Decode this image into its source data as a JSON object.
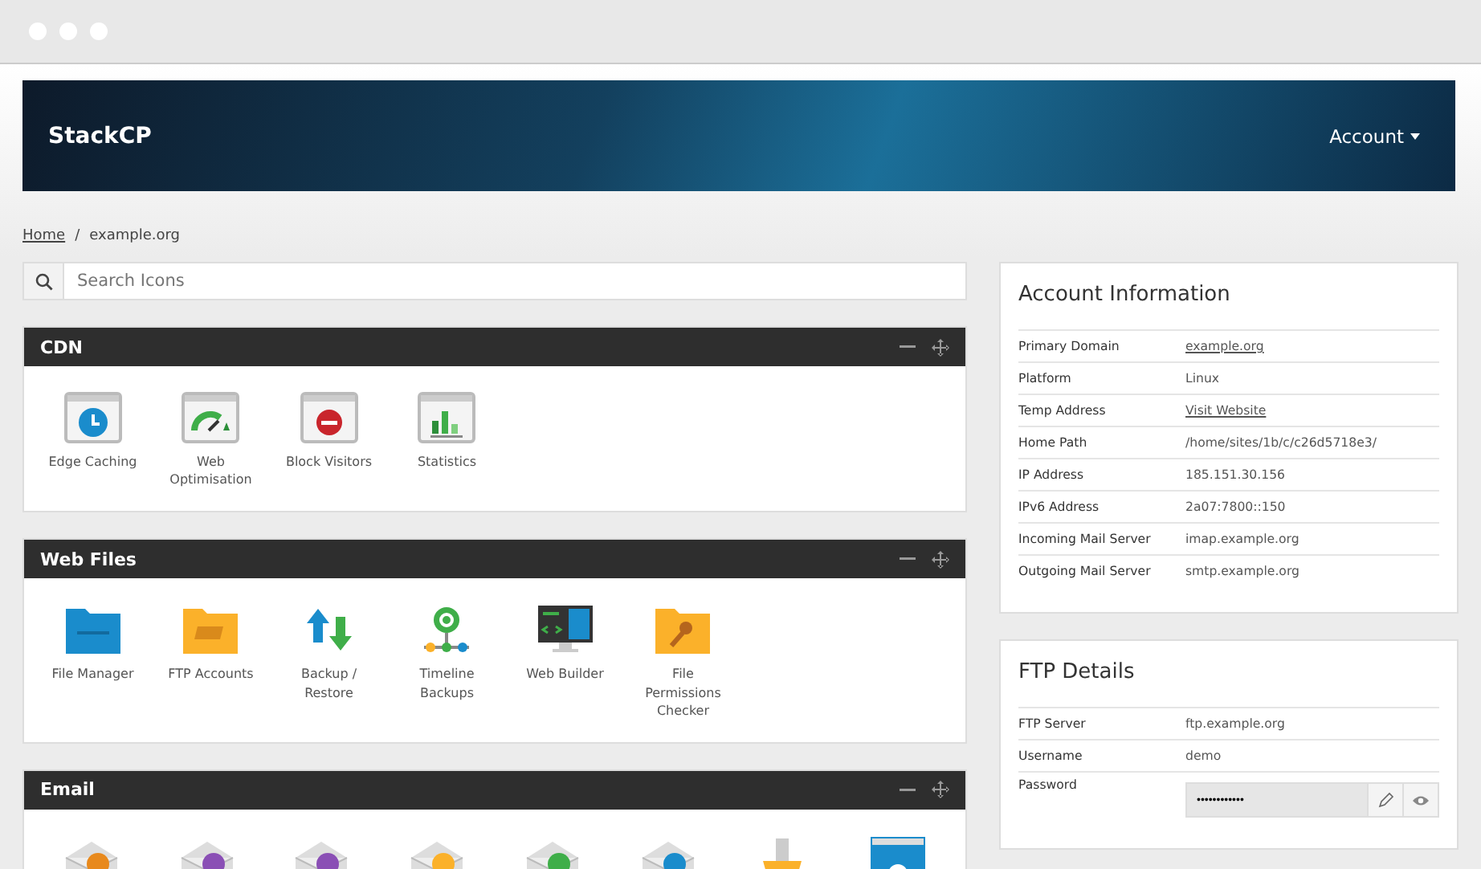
{
  "brand": "StackCP",
  "account_menu": {
    "label": "Account"
  },
  "breadcrumb_separator": "/",
  "breadcrumb": [
    {
      "label": "Home",
      "kind": "link"
    },
    {
      "label": "example.org",
      "kind": "current"
    }
  ],
  "search": {
    "placeholder": "Search Icons"
  },
  "panels": [
    {
      "title": "CDN",
      "items": [
        {
          "label": "Edge Caching",
          "kind": "clock"
        },
        {
          "label": "Web Optimisation",
          "kind": "gauge"
        },
        {
          "label": "Block Visitors",
          "kind": "block"
        },
        {
          "label": "Statistics",
          "kind": "stats"
        }
      ]
    },
    {
      "title": "Web Files",
      "items": [
        {
          "label": "File Manager",
          "kind": "folder"
        },
        {
          "label": "FTP Accounts",
          "kind": "ftp"
        },
        {
          "label": "Backup / Restore",
          "kind": "backup"
        },
        {
          "label": "Timeline Backups",
          "kind": "timeline"
        },
        {
          "label": "Web Builder",
          "kind": "monitor"
        },
        {
          "label": "File Permissions Checker",
          "kind": "keyfolder"
        }
      ]
    },
    {
      "title": "Email",
      "items": [
        {
          "kind": "mail-orange"
        },
        {
          "kind": "mail-purple"
        },
        {
          "kind": "mail-split"
        },
        {
          "kind": "mail-yellow"
        },
        {
          "kind": "mail-green"
        },
        {
          "kind": "mail-blue"
        },
        {
          "kind": "tray"
        },
        {
          "kind": "window"
        }
      ]
    }
  ],
  "account_info": {
    "title": "Account Information",
    "rows": [
      {
        "label": "Primary Domain",
        "value": "example.org",
        "kind": "link"
      },
      {
        "label": "Platform",
        "value": "Linux",
        "kind": "text"
      },
      {
        "label": "Temp Address",
        "value": "Visit Website",
        "kind": "link"
      },
      {
        "label": "Home Path",
        "value": "/home/sites/1b/c/c26d5718e3/",
        "kind": "text"
      },
      {
        "label": "IP Address",
        "value": "185.151.30.156",
        "kind": "text"
      },
      {
        "label": "IPv6 Address",
        "value": "2a07:7800::150",
        "kind": "text"
      },
      {
        "label": "Incoming Mail Server",
        "value": "imap.example.org",
        "kind": "text"
      },
      {
        "label": "Outgoing Mail Server",
        "value": "smtp.example.org",
        "kind": "text"
      }
    ]
  },
  "ftp_details": {
    "title": "FTP Details",
    "rows": [
      {
        "label": "FTP Server",
        "value": "ftp.example.org",
        "kind": "text"
      },
      {
        "label": "Username",
        "value": "demo",
        "kind": "text"
      },
      {
        "label": "Password",
        "value": "••••••••••••",
        "kind": "password"
      }
    ]
  }
}
